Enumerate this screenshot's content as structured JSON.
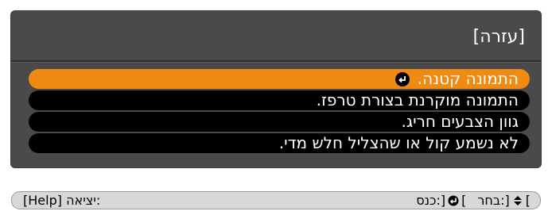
{
  "panel": {
    "title": "[עזרה]"
  },
  "items": [
    {
      "label": "התמונה קטנה.",
      "selected": true
    },
    {
      "label": "התמונה מוקרנת בצורת טרפז.",
      "selected": false
    },
    {
      "label": "גוון הצבעים חריג.",
      "selected": false
    },
    {
      "label": "לא נשמע קול או שהצליל חלש מדי.",
      "selected": false
    }
  ],
  "guide": {
    "select_label": ":בחר",
    "enter_label": ":כנס",
    "exit_label": ":יציאה",
    "help_key": "[Help]",
    "select_icon": "up-down-arrows-icon",
    "enter_icon": "enter-icon"
  },
  "colors": {
    "panel_background": "#4a4a4a",
    "selected_item": "#f08a12",
    "item_background": "#000000",
    "guide_background": "#d8d8d8"
  }
}
